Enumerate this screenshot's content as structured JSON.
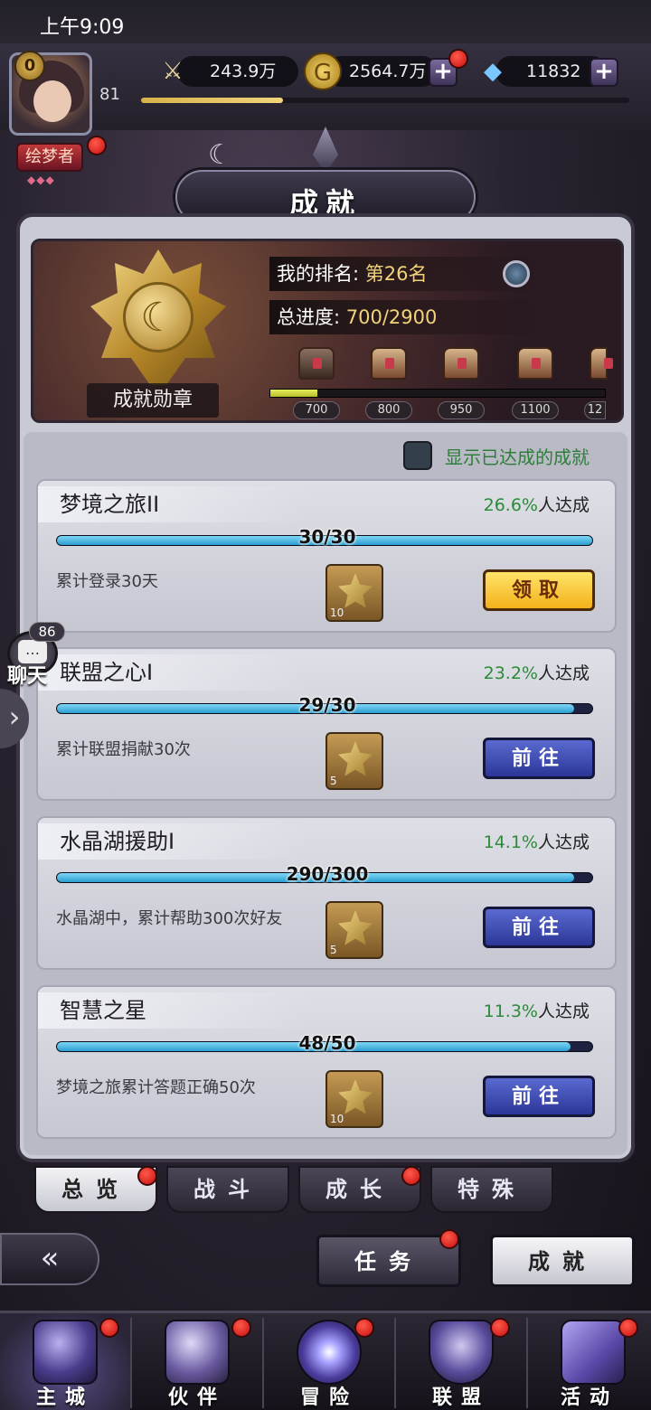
{
  "status_bar": {
    "time": "上午9:09"
  },
  "player": {
    "vip": "0",
    "level": "81",
    "title": "绘梦者",
    "title_stars": "◆◆◆",
    "exp_fraction": 0.29
  },
  "resources": {
    "power": {
      "icon": "sword-icon",
      "value": "243.9万"
    },
    "gold": {
      "icon": "gold-coin-icon",
      "value": "2564.7万"
    },
    "diamond": {
      "icon": "diamond-icon",
      "value": "11832"
    }
  },
  "header": {
    "title": "成就"
  },
  "banner": {
    "medal_label": "成就勋章",
    "rank_label": "我的排名:",
    "rank_value": "第26名",
    "progress_label": "总进度:",
    "progress_value": "700/2900",
    "milestone_fill": 0.14,
    "milestones": [
      "700",
      "800",
      "950",
      "1100",
      "12"
    ]
  },
  "filter": {
    "label": "显示已达成的成就",
    "checked": false
  },
  "achievements": [
    {
      "name": "梦境之旅II",
      "percent": "26.6%",
      "suffix": "人达成",
      "progress": "30/30",
      "fraction": 1.0,
      "desc": "累计登录30天",
      "reward_count": "10",
      "button": "领取",
      "button_type": "claim"
    },
    {
      "name": "联盟之心I",
      "percent": "23.2%",
      "suffix": "人达成",
      "progress": "29/30",
      "fraction": 0.967,
      "desc": "累计联盟捐献30次",
      "reward_count": "5",
      "button": "前往",
      "button_type": "go"
    },
    {
      "name": "水晶湖援助I",
      "percent": "14.1%",
      "suffix": "人达成",
      "progress": "290/300",
      "fraction": 0.967,
      "desc": "水晶湖中，累计帮助300次好友",
      "reward_count": "5",
      "button": "前往",
      "button_type": "go"
    },
    {
      "name": "智慧之星",
      "percent": "11.3%",
      "suffix": "人达成",
      "progress": "48/50",
      "fraction": 0.96,
      "desc": "梦境之旅累计答题正确50次",
      "reward_count": "10",
      "button": "前往",
      "button_type": "go"
    }
  ],
  "chat": {
    "label": "聊天",
    "count": "86"
  },
  "tabs": [
    "总览",
    "战斗",
    "成长",
    "特殊"
  ],
  "nav_buttons": {
    "task": "任务",
    "achievement": "成就"
  },
  "bottom_nav": [
    "主城",
    "伙伴",
    "冒险",
    "联盟",
    "活动"
  ]
}
